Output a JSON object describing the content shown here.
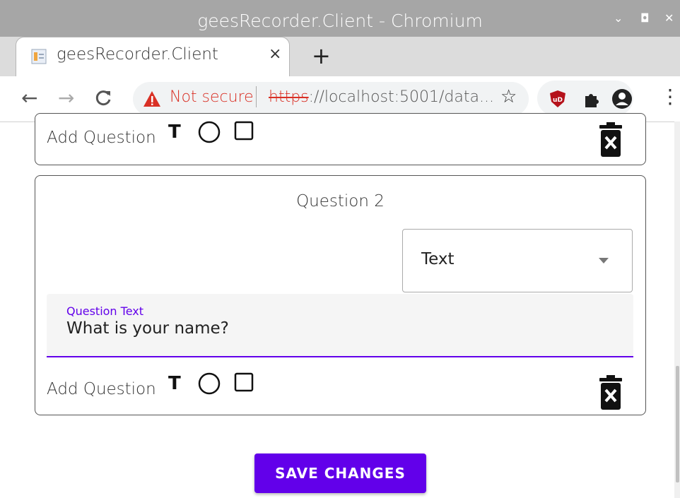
{
  "window": {
    "title": "geesRecorder.Client - Chromium"
  },
  "tab": {
    "label": "geesRecorder.Client",
    "close": "×",
    "new_tab": "+"
  },
  "address_bar": {
    "security_label": "Not secure",
    "url_scheme": "https",
    "url_rest": "://localhost:5001/data..."
  },
  "form": {
    "card1": {
      "add_question_label": "Add Question"
    },
    "card2": {
      "title": "Question 2",
      "type_select": {
        "value": "Text"
      },
      "question_field": {
        "label": "Question Text",
        "value": "What is your name?"
      },
      "add_question_label": "Add Question"
    },
    "save_button": "SAVE CHANGES"
  },
  "colors": {
    "accent": "#6200ea",
    "danger": "#d93025"
  },
  "icons": [
    "text-type-icon",
    "radio-type-icon",
    "checkbox-type-icon",
    "delete-icon"
  ]
}
